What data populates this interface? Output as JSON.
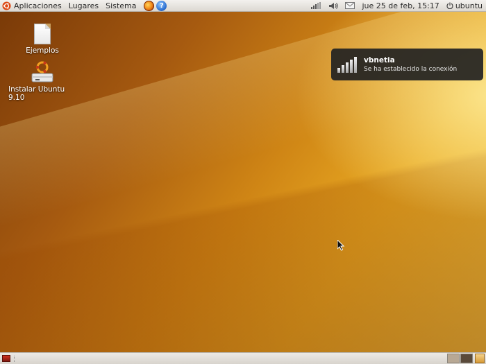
{
  "top_panel": {
    "menus": {
      "applications": "Aplicaciones",
      "places": "Lugares",
      "system": "Sistema"
    },
    "launchers": [
      "firefox-icon",
      "help-icon"
    ],
    "help_glyph": "?",
    "clock": "jue 25 de feb, 15:17",
    "user": "ubuntu"
  },
  "desktop": {
    "icons": [
      {
        "label": "Ejemplos",
        "icon": "file-icon"
      },
      {
        "label": "Instalar Ubuntu 9.10",
        "icon": "installer-icon"
      }
    ]
  },
  "notification": {
    "title": "vbnetia",
    "body": "Se ha establecido la conexión",
    "icon": "network-signal-icon"
  },
  "bottom_panel": {
    "workspaces": 2
  },
  "colors": {
    "panel": "#dcd8d2",
    "notification_bg": "#222222",
    "wallpaper_accent": "#e9aa23"
  }
}
